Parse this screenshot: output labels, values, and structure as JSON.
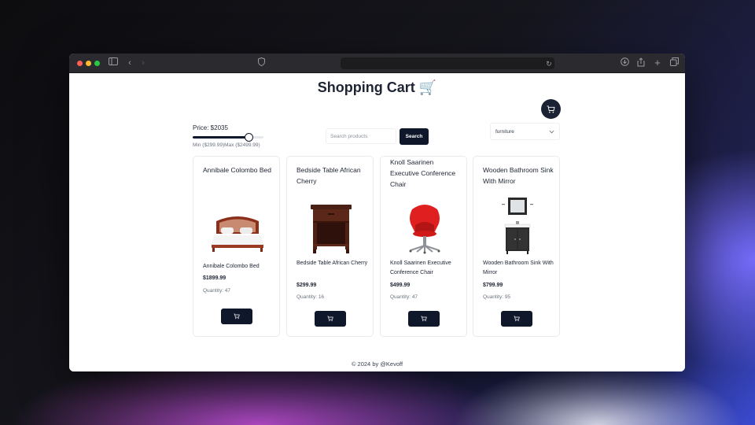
{
  "page": {
    "title": "Shopping Cart",
    "title_emoji": "🛒",
    "footer": "© 2024 by @Kevoff"
  },
  "filters": {
    "price_label": "Price: $2035",
    "price_value": 2035,
    "price_min": 299.99,
    "price_max": 2499.99,
    "min_max_label": "Min ($299.99)Max ($2499.99)",
    "search_placeholder": "Search products",
    "search_button": "Search",
    "category": "furniture"
  },
  "products": [
    {
      "title": "Annibale Colombo Bed",
      "name": "Annibale Colombo Bed",
      "price": "$1899.99",
      "quantity": "Quantity: 47",
      "image": "bed"
    },
    {
      "title": "Bedside Table African Cherry",
      "name": "Bedside Table African Cherry",
      "price": "$299.99",
      "quantity": "Quantity: 16",
      "image": "bedside-table"
    },
    {
      "title": "Knoll Saarinen Executive Conference Chair",
      "name": "Knoll Saarinen Executive Conference Chair",
      "price": "$499.99",
      "quantity": "Quantity: 47",
      "image": "chair"
    },
    {
      "title": "Wooden Bathroom Sink With Mirror",
      "name": "Wooden Bathroom Sink With Mirror",
      "price": "$799.99",
      "quantity": "Quantity: 95",
      "image": "bathroom-sink"
    }
  ],
  "colors": {
    "primary": "#0f172a",
    "chair_red": "#e02020"
  }
}
